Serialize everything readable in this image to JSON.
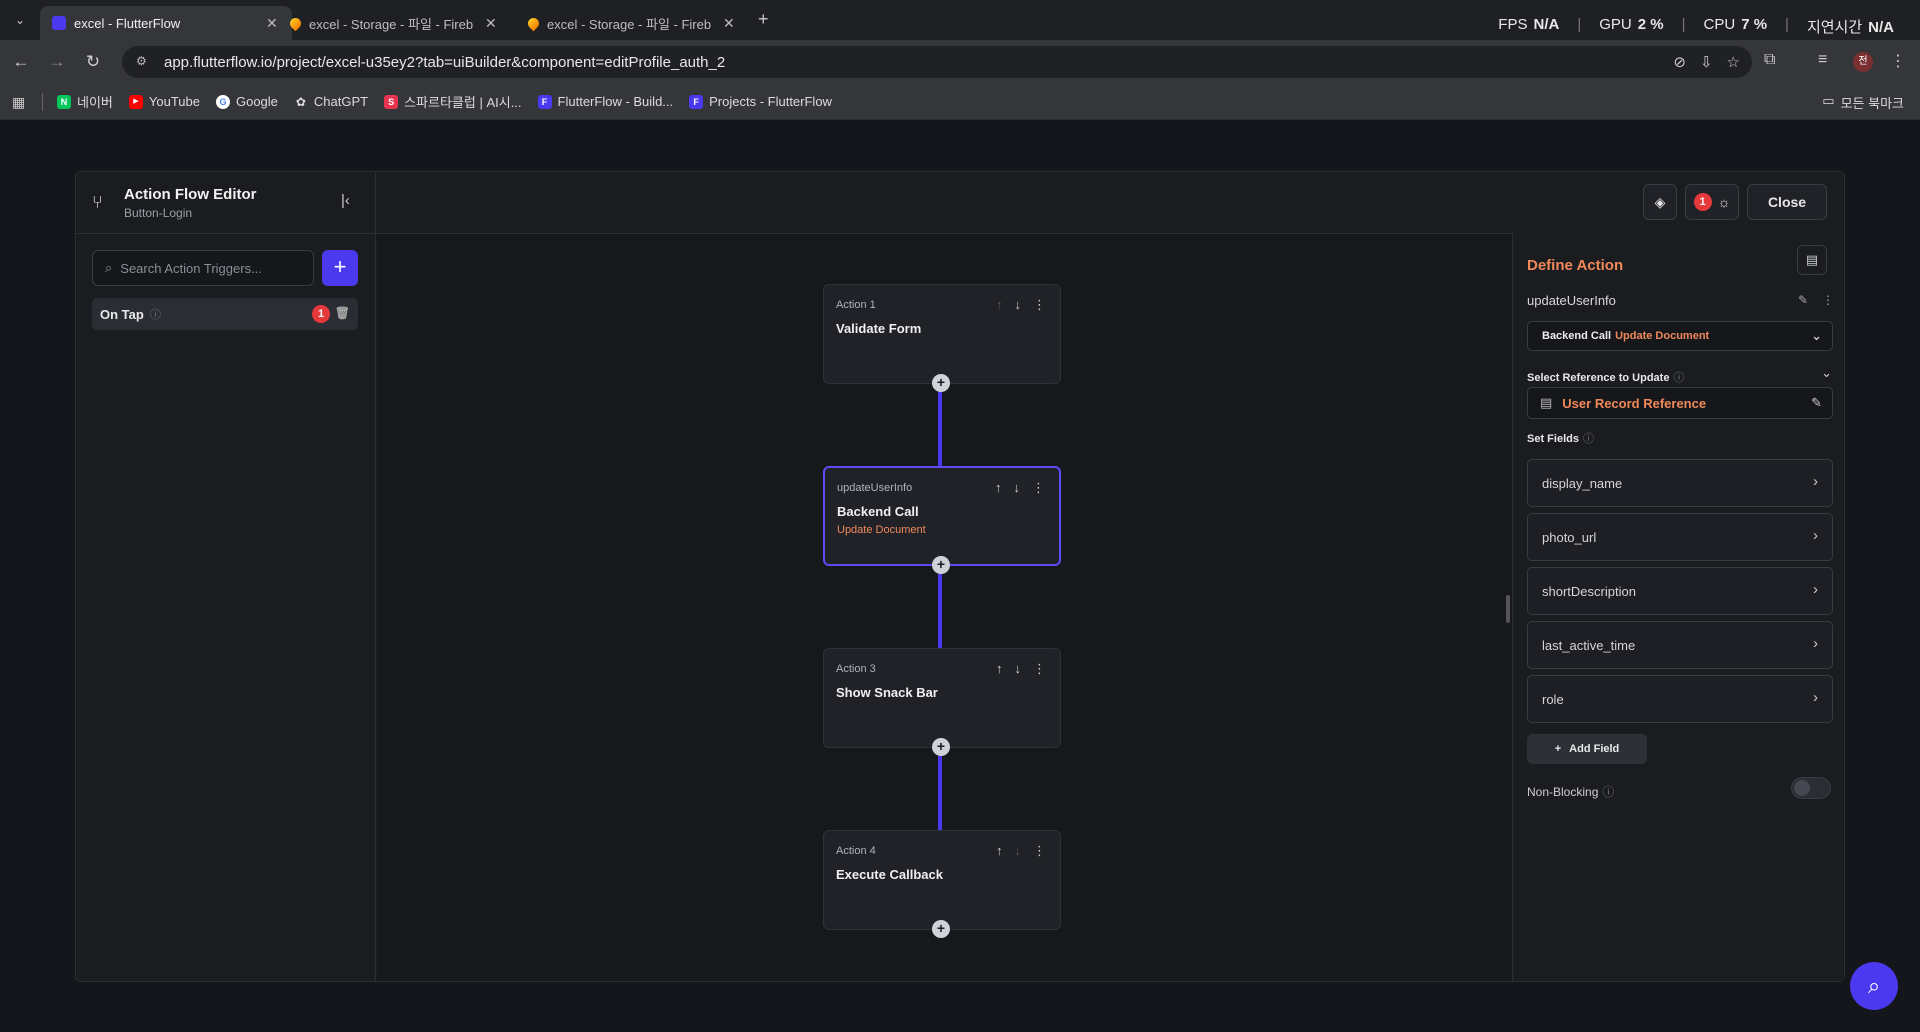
{
  "browser": {
    "tabs": [
      {
        "title": "excel - FlutterFlow",
        "active": true
      },
      {
        "title": "excel - Storage - 파일 - Fireba",
        "active": false
      },
      {
        "title": "excel - Storage - 파일 - Fireba",
        "active": false
      }
    ],
    "perf": {
      "fps_label": "FPS",
      "fps_value": "N/A",
      "gpu_label": "GPU",
      "gpu_value": "2 %",
      "cpu_label": "CPU",
      "cpu_value": "7 %",
      "latency_label": "지연시간",
      "latency_value": "N/A"
    },
    "url": "app.flutterflow.io/project/excel-u35ey2?tab=uiBuilder&component=editProfile_auth_2",
    "profile_initial": "전",
    "bookmarks": [
      {
        "label": "네이버",
        "color": "#03c75a",
        "glyph": "N"
      },
      {
        "label": "YouTube",
        "color": "#ff0000",
        "glyph": "▶"
      },
      {
        "label": "Google",
        "color": "#4285f4",
        "glyph": "G"
      },
      {
        "label": "ChatGPT",
        "color": "#444444",
        "glyph": "✿"
      },
      {
        "label": "스파르타클럽 | AI시...",
        "color": "#e8344e",
        "glyph": "S"
      },
      {
        "label": "FlutterFlow - Build...",
        "color": "#4b39ef",
        "glyph": "F"
      },
      {
        "label": "Projects - FlutterFlow",
        "color": "#4b39ef",
        "glyph": "F"
      }
    ],
    "all_bookmarks": "모든 북마크"
  },
  "editor": {
    "title": "Action Flow Editor",
    "subtitle": "Button-Login",
    "issues_count": "1",
    "close_label": "Close"
  },
  "triggers": {
    "search_placeholder": "Search Action Triggers...",
    "items": [
      {
        "label": "On Tap",
        "badge": "1"
      }
    ]
  },
  "flow": {
    "nodes": [
      {
        "label": "Action 1",
        "title": "Validate Form",
        "subtitle": ""
      },
      {
        "label": "updateUserInfo",
        "title": "Backend Call",
        "subtitle": "Update Document"
      },
      {
        "label": "Action 3",
        "title": "Show Snack Bar",
        "subtitle": ""
      },
      {
        "label": "Action 4",
        "title": "Execute Callback",
        "subtitle": ""
      }
    ]
  },
  "define_action": {
    "title": "Define Action",
    "action_name": "updateUserInfo",
    "action_type": "Backend Call",
    "action_subtype": "Update Document",
    "reference_section": "Select Reference to Update",
    "reference_value": "User Record Reference",
    "fields_section": "Set Fields",
    "fields": [
      "display_name",
      "photo_url",
      "shortDescription",
      "last_active_time",
      "role"
    ],
    "add_field_label": "Add Field",
    "non_blocking_label": "Non-Blocking",
    "non_blocking_enabled": false
  },
  "colors": {
    "accent": "#4b39ef",
    "orange": "#f0885a",
    "badge_red": "#e5393c"
  }
}
